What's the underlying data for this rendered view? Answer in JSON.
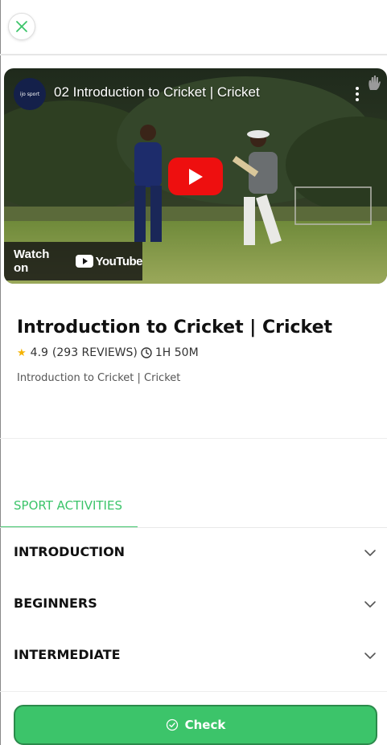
{
  "header": {
    "close_icon": "close-icon"
  },
  "video": {
    "channel_avatar_text": "ijo sport",
    "title": "02 Introduction to Cricket  |  Cricket",
    "watch_on_label": "Watch on",
    "youtube_logo_text": "YouTube",
    "icons": [
      "kebab-menu-icon",
      "hand-icon",
      "play-icon",
      "youtube-logo-icon"
    ]
  },
  "course": {
    "title": "Introduction to Cricket  |  Cricket",
    "rating": "4.9",
    "reviews": "(293 REVIEWS)",
    "duration": "1H 50M",
    "subtitle": "Introduction to Cricket  |  Cricket"
  },
  "tabs": {
    "active_label": "SPORT ACTIVITIES"
  },
  "accordion": [
    {
      "label": "INTRODUCTION"
    },
    {
      "label": "BEGINNERS"
    },
    {
      "label": "INTERMEDIATE"
    }
  ],
  "footer": {
    "check_label": "Check"
  },
  "colors": {
    "accent": "#3cc46a",
    "accent_border": "#2b8a4b",
    "youtube_red": "#ee0f0f",
    "star": "#f5b301"
  }
}
